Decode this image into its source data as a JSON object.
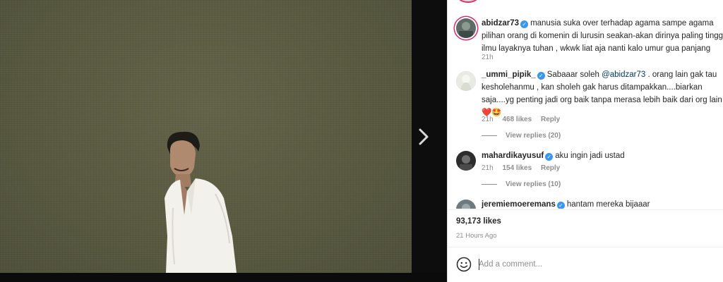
{
  "post": {
    "media_alt": "photo of man in white shirt against olive background"
  },
  "comments": [
    {
      "username": "abidzar73",
      "verified": true,
      "text_lines": [
        "manusia suka over terhadap agama sampe agama",
        "pilihan orang di komenin di lurusin seakan-akan dirinya paling tingg",
        "ilmu layaknya tuhan , wkwk liat aja nanti kalo umur gua panjang"
      ],
      "time": "21h"
    },
    {
      "username": "_ummi_pipik_",
      "verified": true,
      "text_first": "Sabaaar soleh ",
      "mention": "@abidzar73",
      "text_first_tail": " . orang lain gak tau",
      "text_lines": [
        "kesholehanmu , kan sholeh gak harus ditampakkan....biarkan",
        "saja....yg penting jadi org baik tanpa merasa lebih baik dari org lain"
      ],
      "emoji": "❤️🤩",
      "time": "21h",
      "likes": "468 likes",
      "reply": "Reply",
      "view_replies": "View replies (20)"
    },
    {
      "username": "mahardikayusuf",
      "verified": true,
      "text": "aku ingin jadi ustad",
      "time": "21h",
      "likes": "154 likes",
      "reply": "Reply",
      "view_replies": "View replies (10)"
    },
    {
      "username": "jeremiemoeremans",
      "verified": true,
      "text": "hantam mereka bijaaar"
    }
  ],
  "stats": {
    "likes": "93,173 likes",
    "time_ago": "21 Hours Ago"
  },
  "composer": {
    "placeholder": "Add a comment..."
  },
  "icons": {
    "verified": "verified-badge-icon",
    "next": "chevron-right-icon",
    "emoji": "smiley-icon"
  },
  "colors": {
    "verified_blue": "#3897f0",
    "media_bg": "#5b5c46",
    "heart": "#ed4956"
  }
}
